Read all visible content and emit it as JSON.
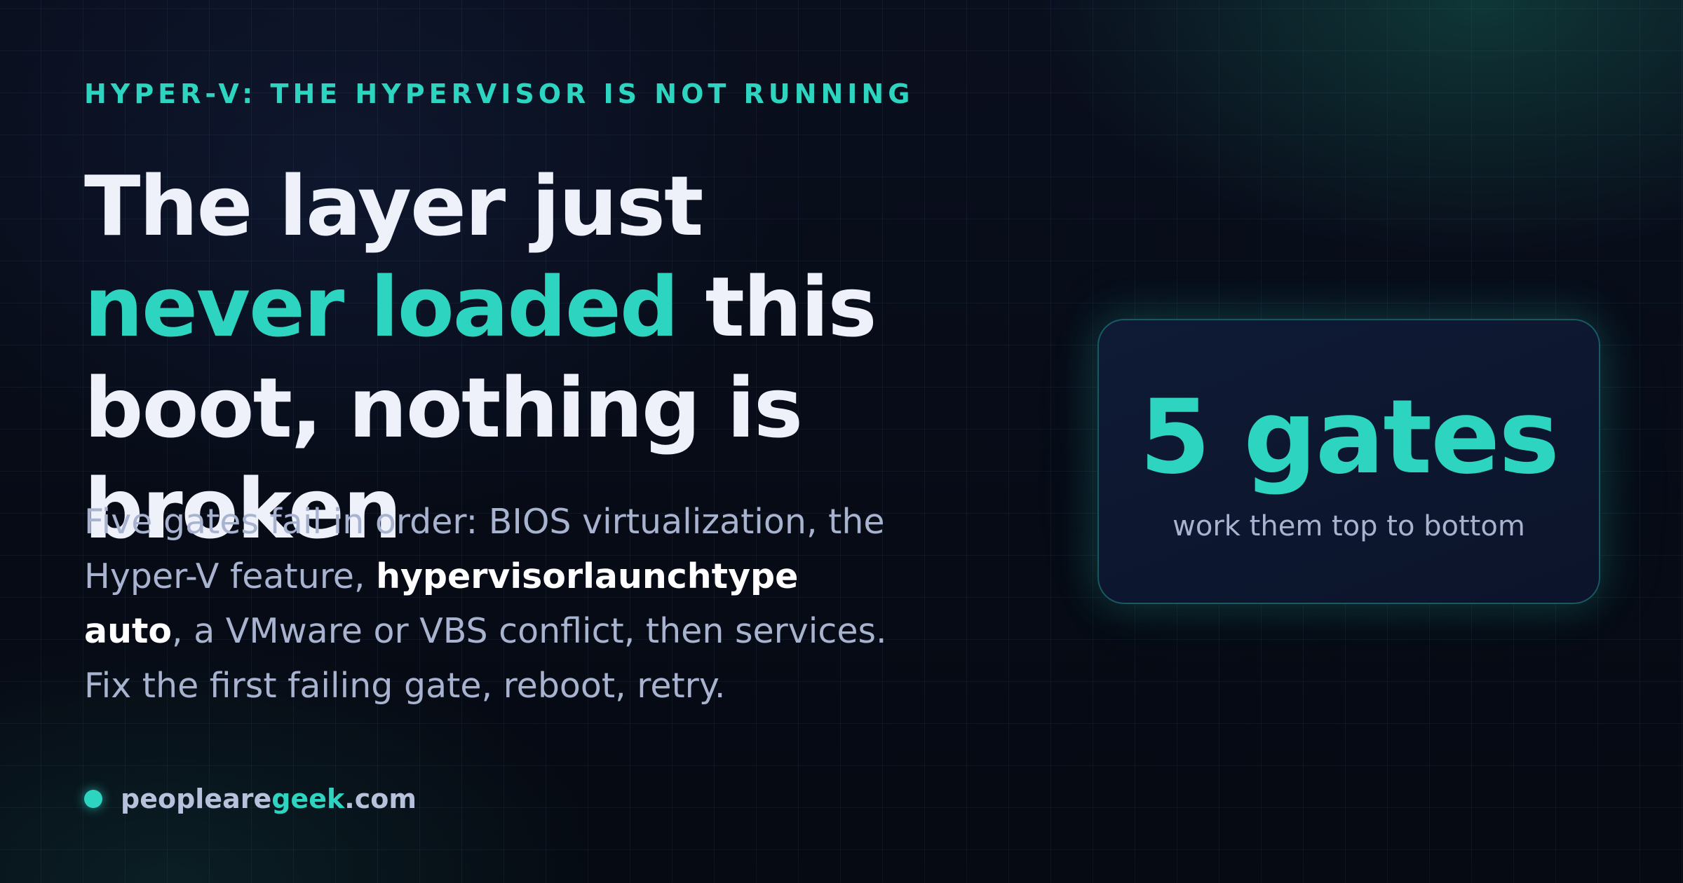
{
  "eyebrow": "HYPER-V: THE HYPERVISOR IS NOT RUNNING",
  "headline": {
    "part1": "The layer just ",
    "accent": "never loaded",
    "part2": " this boot, nothing is broken"
  },
  "body": {
    "part1": "Five gates fail in order: BIOS virtualization, the Hyper-V feature, ",
    "bold": "hypervisorlaunchtype auto",
    "part2": ", a VMware or VBS conflict, then services. Fix the first failing gate, reboot, retry."
  },
  "site": {
    "prefix": "peoplearegeek",
    "suffix": ".com",
    "accent_part": "geek",
    "lead": "peopleare"
  },
  "card": {
    "big": "5 gates",
    "sub": "work them top to bottom"
  },
  "colors": {
    "accent": "#2dd4bf",
    "background": "#070b16",
    "headline": "#eef0fa",
    "body": "#a8b3cf"
  }
}
